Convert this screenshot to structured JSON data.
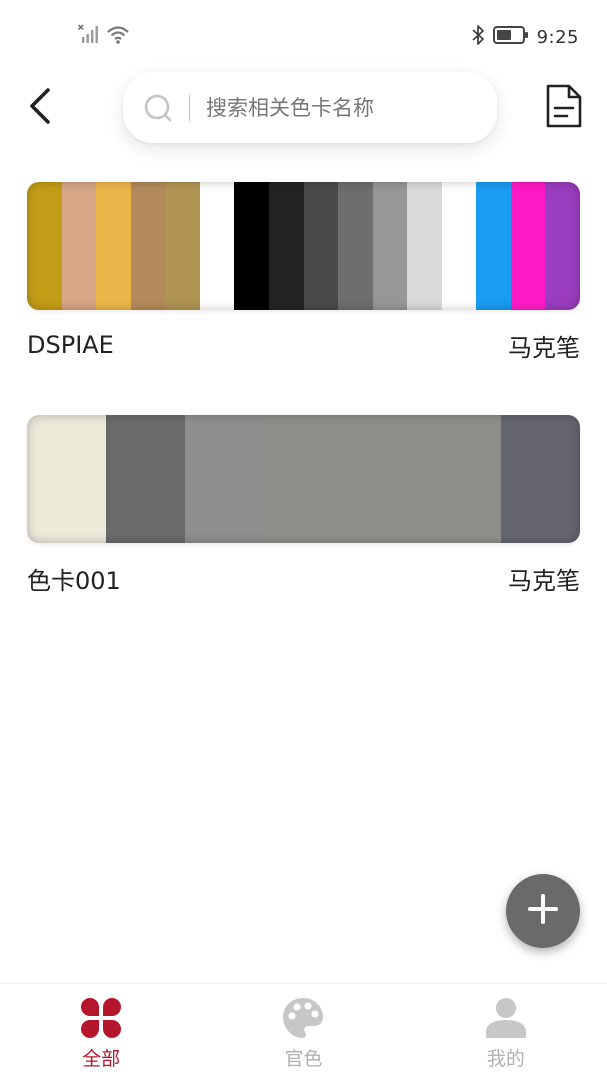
{
  "status_bar": {
    "time": "9:25",
    "signal_icon": "signal-no-sim-icon",
    "wifi_icon": "wifi-icon",
    "bluetooth_icon": "bluetooth-icon",
    "battery_icon": "battery-icon"
  },
  "header": {
    "back_icon": "chevron-left-icon",
    "search": {
      "placeholder": "搜索相关色卡名称",
      "value": ""
    },
    "doc_icon": "document-icon"
  },
  "cards": [
    {
      "name": "DSPIAE",
      "type": "马克笔",
      "swatches": [
        "#c49d17",
        "#d6a686",
        "#ecb64a",
        "#b38a5c",
        "#b09452",
        "#ffffff",
        "#000000",
        "#232323",
        "#4a4a4a",
        "#6e6e6e",
        "#979797",
        "#d9d9d9",
        "#ffffff",
        "#1a9cf2",
        "#ff1ac7",
        "#9a3dbe"
      ]
    },
    {
      "name": "色卡001",
      "type": "马克笔",
      "swatches": [
        "#ebe9d8",
        "#6a6a6a",
        "#8f8f8f",
        "#8e8e8b",
        "#8e8e8b",
        "#8e8e8a",
        "#656570"
      ]
    }
  ],
  "fab": {
    "icon": "plus-icon",
    "color": "#6a6a6a"
  },
  "bottom_nav": {
    "accent_color": "#b5162b",
    "inactive_color": "#b0b0b0",
    "items": [
      {
        "label": "全部",
        "icon": "four-petal-grid-icon",
        "active": true
      },
      {
        "label": "官色",
        "icon": "palette-icon",
        "active": false
      },
      {
        "label": "我的",
        "icon": "person-icon",
        "active": false
      }
    ]
  }
}
